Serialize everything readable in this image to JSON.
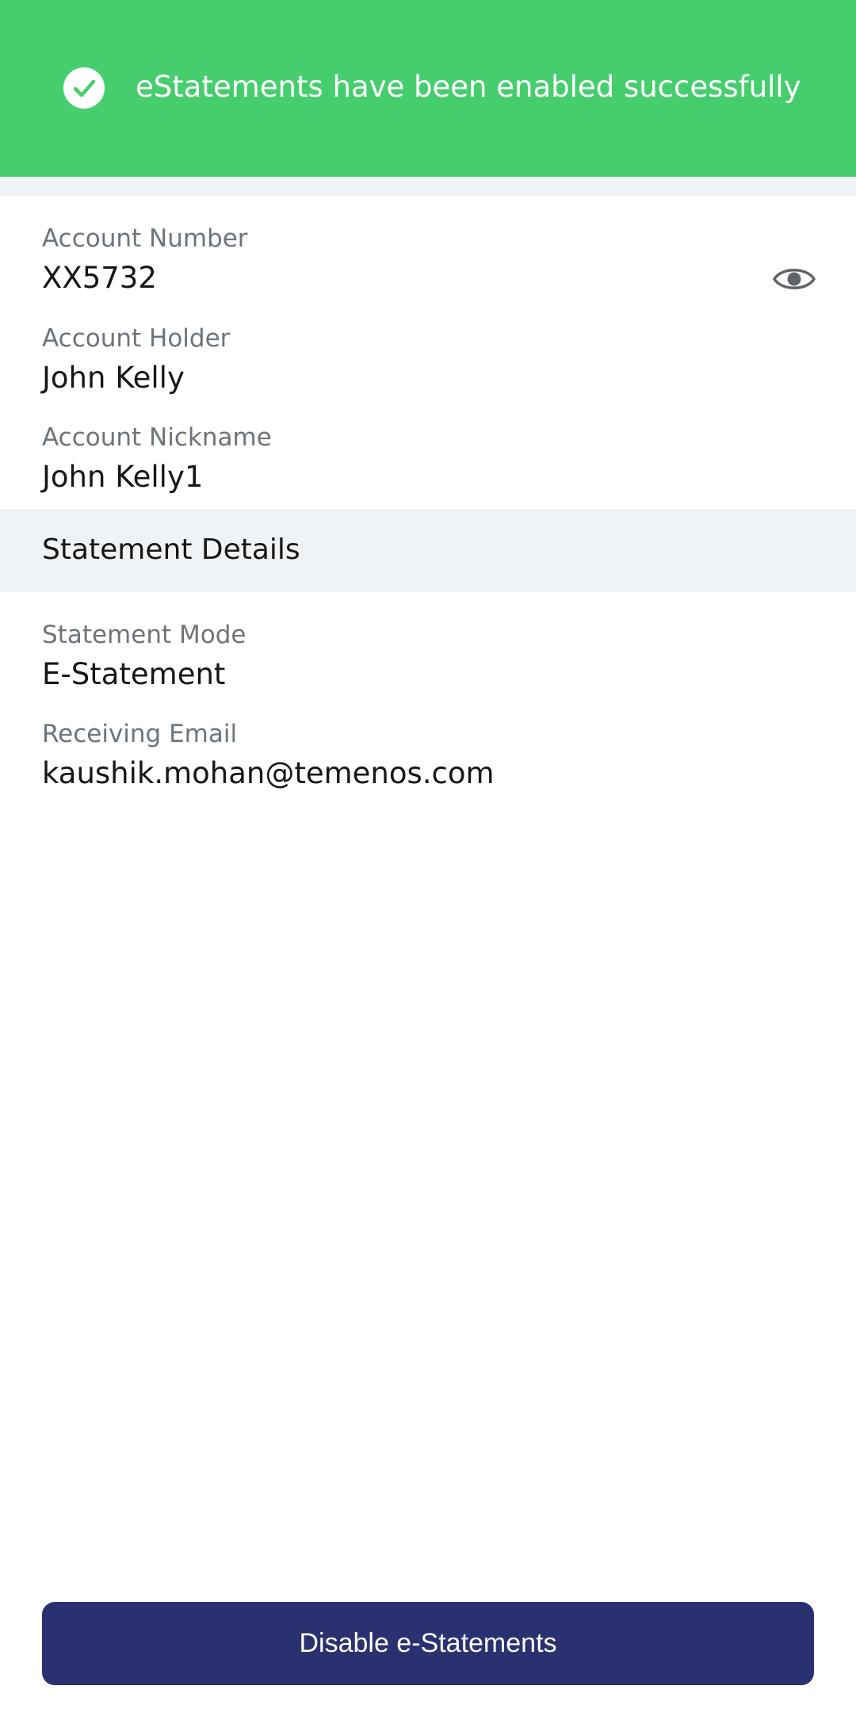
{
  "banner": {
    "message": "eStatements have been enabled successfully",
    "icon": "check-circle-icon",
    "color": "#46ce6e"
  },
  "account": {
    "number_label": "Account Number",
    "number_value": "XX5732",
    "holder_label": "Account Holder",
    "holder_value": "John Kelly",
    "nickname_label": "Account Nickname",
    "nickname_value": "John Kelly1",
    "reveal_icon": "eye-icon"
  },
  "statement_details": {
    "title": "Statement Details",
    "mode_label": "Statement Mode",
    "mode_value": "E-Statement",
    "email_label": "Receiving Email",
    "email_value": "kaushik.mohan@temenos.com"
  },
  "actions": {
    "disable_label": "Disable e-Statements",
    "button_color": "#2a3170"
  }
}
